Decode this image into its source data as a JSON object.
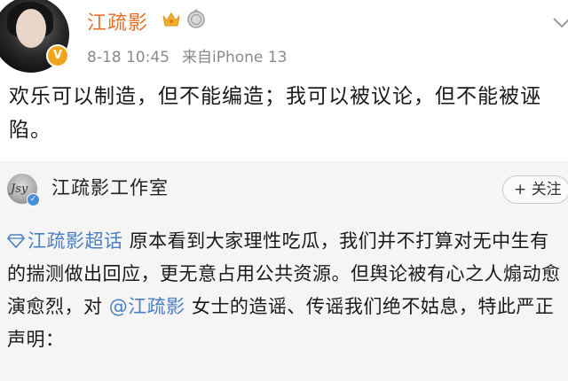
{
  "post": {
    "author": "江疏影",
    "time": "8-18 10:45",
    "source": "来自iPhone 13",
    "text": "欢乐可以制造，但不能编造；我可以被议论，但不能被诬陷。",
    "badge_letter": "V"
  },
  "repost": {
    "author": "江疏影工作室",
    "follow_label": "+ 关注",
    "topic": "江疏影超话",
    "text_part1": " 原本看到大家理性吃瓜，我们并不打算对无中生有的揣测做出回应，更无意占用公共资源。但舆论被有心之人煽动愈演愈烈，对 ",
    "mention": "@江疏影",
    "text_part2": " 女士的造谣、传谣我们绝不姑息，特此严正声明："
  },
  "colors": {
    "author_orange": "#e8722a",
    "link_blue": "#4a7fc1",
    "meta_gray": "#8a8a8a",
    "card_bg": "#f5f5f5"
  },
  "icons": {
    "crown": "crown-icon",
    "medal": "medal-icon",
    "verified": "verified-icon",
    "chevron": "chevron-down-icon",
    "topic": "topic-diamond-icon"
  }
}
